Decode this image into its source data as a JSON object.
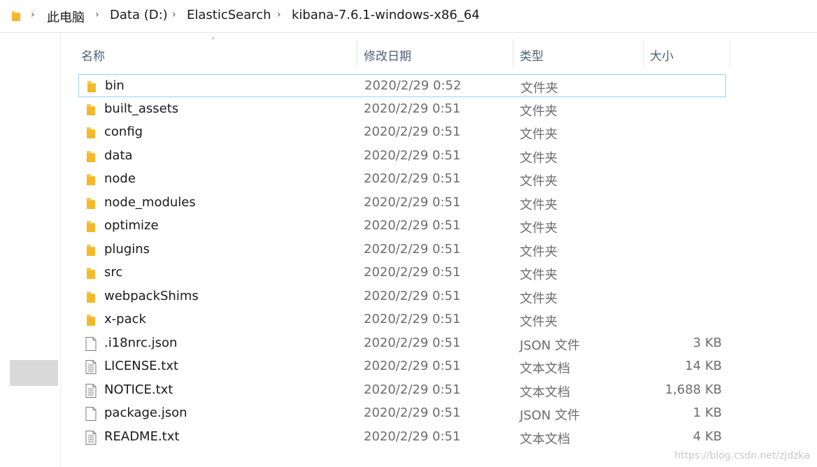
{
  "breadcrumb": [
    "此电脑",
    "Data (D:)",
    "ElasticSearch",
    "kibana-7.6.1-windows-x86_64"
  ],
  "columns": {
    "name": "名称",
    "date": "修改日期",
    "type": "类型",
    "size": "大小"
  },
  "files": [
    {
      "name": "bin",
      "date": "2020/2/29 0:52",
      "type": "文件夹",
      "size": "",
      "icon": "folder-icon"
    },
    {
      "name": "built_assets",
      "date": "2020/2/29 0:51",
      "type": "文件夹",
      "size": "",
      "icon": "folder-icon"
    },
    {
      "name": "config",
      "date": "2020/2/29 0:51",
      "type": "文件夹",
      "size": "",
      "icon": "folder-icon"
    },
    {
      "name": "data",
      "date": "2020/2/29 0:51",
      "type": "文件夹",
      "size": "",
      "icon": "folder-icon"
    },
    {
      "name": "node",
      "date": "2020/2/29 0:51",
      "type": "文件夹",
      "size": "",
      "icon": "folder-icon"
    },
    {
      "name": "node_modules",
      "date": "2020/2/29 0:51",
      "type": "文件夹",
      "size": "",
      "icon": "folder-icon"
    },
    {
      "name": "optimize",
      "date": "2020/2/29 0:51",
      "type": "文件夹",
      "size": "",
      "icon": "folder-icon"
    },
    {
      "name": "plugins",
      "date": "2020/2/29 0:51",
      "type": "文件夹",
      "size": "",
      "icon": "folder-icon"
    },
    {
      "name": "src",
      "date": "2020/2/29 0:51",
      "type": "文件夹",
      "size": "",
      "icon": "folder-icon"
    },
    {
      "name": "webpackShims",
      "date": "2020/2/29 0:51",
      "type": "文件夹",
      "size": "",
      "icon": "folder-icon"
    },
    {
      "name": "x-pack",
      "date": "2020/2/29 0:51",
      "type": "文件夹",
      "size": "",
      "icon": "folder-icon"
    },
    {
      "name": ".i18nrc.json",
      "date": "2020/2/29 0:51",
      "type": "JSON 文件",
      "size": "3 KB",
      "icon": "file-icon"
    },
    {
      "name": "LICENSE.txt",
      "date": "2020/2/29 0:51",
      "type": "文本文档",
      "size": "14 KB",
      "icon": "text-file-icon"
    },
    {
      "name": "NOTICE.txt",
      "date": "2020/2/29 0:51",
      "type": "文本文档",
      "size": "1,688 KB",
      "icon": "text-file-icon"
    },
    {
      "name": "package.json",
      "date": "2020/2/29 0:51",
      "type": "JSON 文件",
      "size": "1 KB",
      "icon": "file-icon"
    },
    {
      "name": "README.txt",
      "date": "2020/2/29 0:51",
      "type": "文本文档",
      "size": "4 KB",
      "icon": "text-file-icon"
    }
  ],
  "selected_index": 0,
  "colors": {
    "folder": "#f8c84a",
    "selection_border": "#99d1ff",
    "header_text": "#4c607a"
  },
  "watermark": "https://blog.csdn.net/zjdzka"
}
